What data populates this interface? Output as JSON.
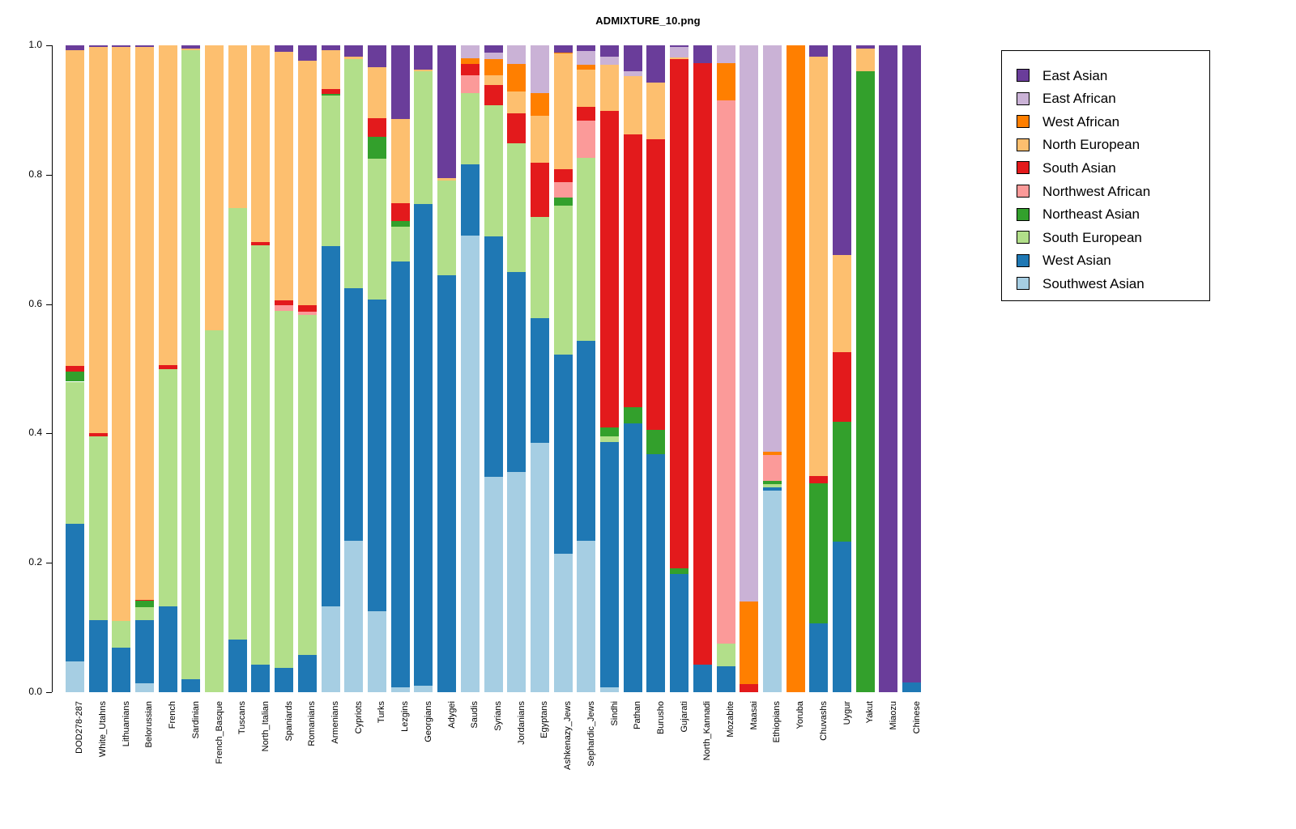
{
  "title": "ADMIXTURE_10.png",
  "axis": {
    "y_ticks": [
      "0.0",
      "0.2",
      "0.4",
      "0.6",
      "0.8",
      "1.0"
    ],
    "ylim": [
      0,
      1
    ]
  },
  "legend": {
    "position": "right",
    "items": [
      {
        "label": "East Asian",
        "color": "#6A3D9A"
      },
      {
        "label": "East African",
        "color": "#CAB2D6"
      },
      {
        "label": "West African",
        "color": "#FF7F00"
      },
      {
        "label": "North European",
        "color": "#FDBF6F"
      },
      {
        "label": "South Asian",
        "color": "#E31A1C"
      },
      {
        "label": "Northwest African",
        "color": "#FB9A99"
      },
      {
        "label": "Northeast Asian",
        "color": "#33A02C"
      },
      {
        "label": "South European",
        "color": "#B2DF8A"
      },
      {
        "label": "West Asian",
        "color": "#1F78B4"
      },
      {
        "label": "Southwest Asian",
        "color": "#A6CEE3"
      }
    ]
  },
  "chart_data": {
    "type": "bar",
    "stacked": true,
    "normalized": true,
    "title": "ADMIXTURE_10.png",
    "xlabel": "",
    "ylabel": "",
    "ylim": [
      0,
      1
    ],
    "grid": false,
    "components": [
      "Southwest Asian",
      "West Asian",
      "South European",
      "Northeast Asian",
      "Northwest African",
      "South Asian",
      "North European",
      "West African",
      "East African",
      "East Asian"
    ],
    "component_colors": {
      "Southwest Asian": "#A6CEE3",
      "West Asian": "#1F78B4",
      "South European": "#B2DF8A",
      "Northeast Asian": "#33A02C",
      "Northwest African": "#FB9A99",
      "South Asian": "#E31A1C",
      "North European": "#FDBF6F",
      "West African": "#FF7F00",
      "East African": "#CAB2D6",
      "East Asian": "#6A3D9A"
    },
    "categories": [
      "DOD278-287",
      "White_Utahns",
      "Lithuanians",
      "Belorussian",
      "French",
      "Sardinian",
      "French_Basque",
      "Tuscans",
      "North_Italian",
      "Spaniards",
      "Romanians",
      "Armenians",
      "Cypriots",
      "Turks",
      "Lezgins",
      "Georgians",
      "Adygei",
      "Saudis",
      "Syrians",
      "Jordanians",
      "Egyptans",
      "Ashkenazy_Jews",
      "Sephardic_Jews",
      "Sindhi",
      "Pathan",
      "Burusho",
      "Gujarati",
      "North_Kannadi",
      "Mozabite",
      "Maasai",
      "Ethiopians",
      "Yoruba",
      "Chuvashs",
      "Uygur",
      "Yakut",
      "Miaozu",
      "Chinese"
    ],
    "series": [
      {
        "name": "Southwest Asian",
        "color": "#A6CEE3",
        "values": [
          0.047,
          0.0,
          0.0,
          0.014,
          0.0,
          0.0,
          0.0,
          0.0,
          0.0,
          0.0,
          0.0,
          0.133,
          0.234,
          0.125,
          0.008,
          0.01,
          0.0,
          0.77,
          0.333,
          0.34,
          0.386,
          0.19,
          0.215,
          0.008,
          0.0,
          0.0,
          0.0,
          0.0,
          0.0,
          0.0,
          0.312,
          0.0,
          0.0,
          0.0,
          0.0,
          0.0,
          0.0
        ]
      },
      {
        "name": "West Asian",
        "color": "#1F78B4",
        "values": [
          0.213,
          0.112,
          0.069,
          0.098,
          0.133,
          0.02,
          0.0,
          0.081,
          0.042,
          0.038,
          0.058,
          0.557,
          0.39,
          0.482,
          0.658,
          0.745,
          0.645,
          0.119,
          0.372,
          0.309,
          0.192,
          0.274,
          0.285,
          0.379,
          0.415,
          0.368,
          0.183,
          0.043,
          0.04,
          0.0,
          0.005,
          0.0,
          0.106,
          0.233,
          0.0,
          0.0,
          0.015
        ]
      },
      {
        "name": "South European",
        "color": "#B2DF8A",
        "values": [
          0.22,
          0.283,
          0.041,
          0.019,
          0.367,
          0.972,
          0.56,
          0.667,
          0.649,
          0.552,
          0.525,
          0.232,
          0.355,
          0.218,
          0.054,
          0.205,
          0.146,
          0.12,
          0.202,
          0.2,
          0.157,
          0.205,
          0.26,
          0.008,
          0.0,
          0.0,
          0.0,
          0.0,
          0.035,
          0.0,
          0.005,
          0.0,
          0.0,
          0.0,
          0.0,
          0.0,
          0.0
        ]
      },
      {
        "name": "Northeast Asian",
        "color": "#33A02C",
        "values": [
          0.016,
          0.0,
          0.0,
          0.01,
          0.0,
          0.0,
          0.0,
          0.0,
          0.0,
          0.0,
          0.0,
          0.003,
          0.0,
          0.033,
          0.008,
          0.0,
          0.0,
          0.0,
          0.0,
          0.0,
          0.0,
          0.012,
          0.0,
          0.014,
          0.025,
          0.037,
          0.008,
          0.0,
          0.0,
          0.0,
          0.005,
          0.0,
          0.215,
          0.185,
          0.96,
          0.0,
          0.0
        ]
      },
      {
        "name": "Northwest African",
        "color": "#FB9A99",
        "values": [
          0.0,
          0.0,
          0.0,
          0.0,
          0.0,
          0.0,
          0.0,
          0.0,
          0.0,
          0.008,
          0.005,
          0.0,
          0.0,
          0.0,
          0.0,
          0.0,
          0.0,
          0.03,
          0.0,
          0.0,
          0.0,
          0.021,
          0.053,
          0.0,
          0.0,
          0.0,
          0.0,
          0.0,
          0.84,
          0.0,
          0.04,
          0.0,
          0.0,
          0.0,
          0.0,
          0.0,
          0.0
        ]
      },
      {
        "name": "South Asian",
        "color": "#E31A1C",
        "values": [
          0.009,
          0.005,
          0.0,
          0.002,
          0.006,
          0.0,
          0.0,
          0.0,
          0.005,
          0.008,
          0.01,
          0.007,
          0.0,
          0.03,
          0.028,
          0.0,
          0.0,
          0.02,
          0.032,
          0.046,
          0.083,
          0.018,
          0.019,
          0.49,
          0.422,
          0.45,
          0.788,
          0.93,
          0.0,
          0.012,
          0.0,
          0.0,
          0.012,
          0.108,
          0.0,
          0.0,
          0.0
        ]
      },
      {
        "name": "North European",
        "color": "#FDBF6F",
        "values": [
          0.488,
          0.598,
          0.887,
          0.855,
          0.494,
          0.003,
          0.44,
          0.252,
          0.304,
          0.384,
          0.378,
          0.06,
          0.003,
          0.078,
          0.13,
          0.003,
          0.004,
          0.0,
          0.015,
          0.034,
          0.073,
          0.159,
          0.053,
          0.071,
          0.09,
          0.088,
          0.002,
          0.0,
          0.0,
          0.0,
          0.0,
          0.0,
          0.645,
          0.15,
          0.035,
          0.0,
          0.0
        ]
      },
      {
        "name": "West African",
        "color": "#FF7F00",
        "values": [
          0.0,
          0.0,
          0.0,
          0.0,
          0.0,
          0.0,
          0.0,
          0.0,
          0.0,
          0.0,
          0.0,
          0.0,
          0.0,
          0.0,
          0.0,
          0.0,
          0.0,
          0.009,
          0.025,
          0.042,
          0.035,
          0.001,
          0.007,
          0.0,
          0.0,
          0.0,
          0.0,
          0.0,
          0.058,
          0.128,
          0.005,
          1.0,
          0.0,
          0.0,
          0.0,
          0.0,
          0.0
        ]
      },
      {
        "name": "East African",
        "color": "#CAB2D6",
        "values": [
          0.0,
          0.0,
          0.0,
          0.0,
          0.0,
          0.0,
          0.0,
          0.0,
          0.0,
          0.0,
          0.0,
          0.0,
          0.0,
          0.0,
          0.0,
          0.0,
          0.0,
          0.022,
          0.01,
          0.029,
          0.074,
          0.0,
          0.02,
          0.013,
          0.008,
          0.0,
          0.017,
          0.0,
          0.027,
          0.86,
          0.628,
          0.0,
          0.0,
          0.0,
          0.0,
          0.0,
          0.0
        ]
      },
      {
        "name": "East Asian",
        "color": "#6A3D9A",
        "values": [
          0.007,
          0.002,
          0.003,
          0.002,
          0.0,
          0.005,
          0.0,
          0.0,
          0.0,
          0.01,
          0.024,
          0.008,
          0.018,
          0.034,
          0.114,
          0.037,
          0.205,
          0.0,
          0.011,
          0.0,
          0.0,
          0.01,
          0.008,
          0.017,
          0.04,
          0.057,
          0.002,
          0.027,
          0.0,
          0.0,
          0.0,
          0.0,
          0.017,
          0.324,
          0.005,
          1.0,
          0.985
        ]
      }
    ]
  }
}
